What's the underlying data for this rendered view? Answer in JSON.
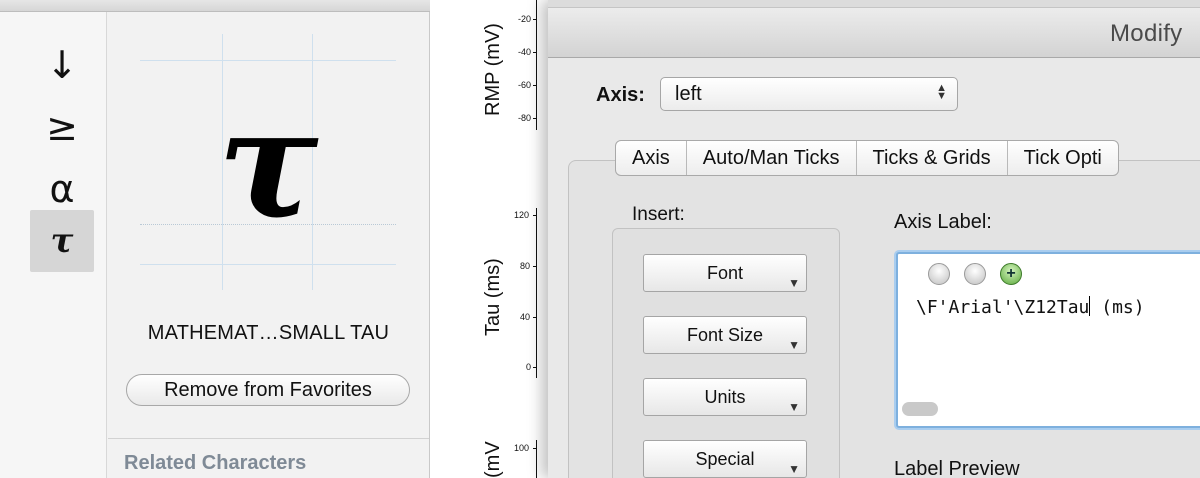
{
  "character_viewer": {
    "list_items": [
      {
        "glyph": "↓",
        "name": "downwards-arrow-icon"
      },
      {
        "glyph": "≥",
        "name": "greater-equal-icon"
      },
      {
        "glyph": "α",
        "name": "alpha-icon"
      },
      {
        "glyph": "τ",
        "name": "tau-icon"
      }
    ],
    "selected_glyph": "τ",
    "character_name": "MATHEMAT…SMALL TAU",
    "favorites_button": "Remove from Favorites",
    "related_heading": "Related Characters"
  },
  "graph": {
    "panels": [
      {
        "ylabel": "RMP (mV)",
        "ticks": [
          "-20",
          "-40",
          "-60",
          "-80"
        ]
      },
      {
        "ylabel": "Tau (ms)",
        "ticks": [
          "120",
          "80",
          "40",
          "0"
        ]
      },
      {
        "ylabel": "(mV",
        "ticks": [
          "100"
        ]
      }
    ]
  },
  "dialog": {
    "title": "Modify",
    "axis_label": "Axis:",
    "axis_value": "left",
    "tabs": [
      "Axis",
      "Auto/Man Ticks",
      "Ticks & Grids",
      "Tick Opti"
    ],
    "insert_label": "Insert:",
    "insert_buttons": [
      "Font",
      "Font Size",
      "Units",
      "Special"
    ],
    "axis_label_heading": "Axis Label:",
    "label_text_before": "\\F'Arial'\\Z12Tau",
    "label_text_after": "(ms)",
    "label_preview_heading": "Label Preview"
  }
}
